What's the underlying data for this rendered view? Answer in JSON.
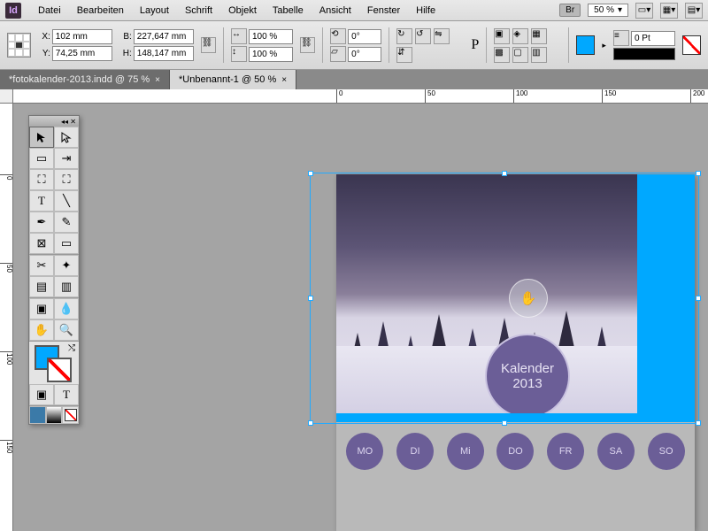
{
  "app": {
    "icon_text": "Id"
  },
  "menu": [
    "Datei",
    "Bearbeiten",
    "Layout",
    "Schrift",
    "Objekt",
    "Tabelle",
    "Ansicht",
    "Fenster",
    "Hilfe"
  ],
  "menubar_right": {
    "br": "Br",
    "zoom": "50 %"
  },
  "control": {
    "x": "102 mm",
    "y": "74,25 mm",
    "w_label": "B:",
    "w": "227,647 mm",
    "h_label": "H:",
    "h": "148,147 mm",
    "scale_x": "100 %",
    "scale_y": "100 %",
    "rotate": "0°",
    "shear": "0°",
    "stroke_pt": "0 Pt"
  },
  "tabs": [
    {
      "label": "*fotokalender-2013.indd @ 75 %",
      "active": false
    },
    {
      "label": "*Unbenannt-1 @ 50 %",
      "active": true
    }
  ],
  "ruler_h": [
    "0",
    "50",
    "100",
    "150",
    "200"
  ],
  "ruler_v": [
    "0",
    "50",
    "100",
    "150"
  ],
  "calendar": {
    "title_line1": "Kalender",
    "title_line2": "2013",
    "days": [
      "MO",
      "DI",
      "Mi",
      "DO",
      "FR",
      "SA",
      "SO"
    ]
  },
  "colors": {
    "accent": "#00a8ff",
    "circle": "#6b5e97"
  }
}
